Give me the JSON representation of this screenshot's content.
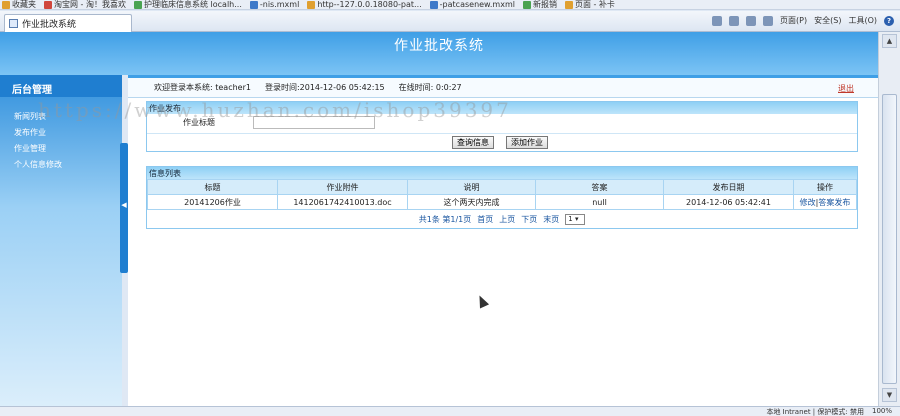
{
  "browser": {
    "favorites_label": "收藏夹",
    "bookmarks": [
      {
        "label": "淘宝网 - 淘！我喜欢"
      },
      {
        "label": "护理临床信息系统 localh..."
      },
      {
        "label": "-nis.mxml"
      },
      {
        "label": "http--127.0.0.18080-pat..."
      },
      {
        "label": "-patcasenew.mxml"
      },
      {
        "label": "新报销"
      },
      {
        "label": "页面 - 补卡"
      }
    ],
    "tab_title": "作业批改系统",
    "tools": {
      "page": "页面(P)",
      "safety": "安全(S)",
      "tools": "工具(O)"
    },
    "status": {
      "zone": "本地 Intranet | 保护模式: 禁用",
      "zoom": "100%"
    }
  },
  "app": {
    "title": "作业批改系统"
  },
  "sidebar": {
    "title": "后台管理",
    "items": [
      {
        "label": "新闻列表"
      },
      {
        "label": "发布作业"
      },
      {
        "label": "作业管理"
      },
      {
        "label": "个人信息修改"
      }
    ],
    "toggle": "◀"
  },
  "header": {
    "welcome": "欢迎登录本系统: teacher1",
    "login_time": "登录时间:2014-12-06 05:42:15",
    "online_time": "在线时间: 0:0:27",
    "logout": "退出"
  },
  "search_panel": {
    "title": "作业发布",
    "field_label": "作业标题",
    "field_value": "",
    "query_button": "查询信息",
    "add_button": "添加作业"
  },
  "list_panel": {
    "title": "信息列表",
    "columns": [
      "标题",
      "作业附件",
      "说明",
      "答案",
      "发布日期",
      "操作"
    ],
    "rows": [
      {
        "title": "20141206作业",
        "attachment": "1412061742410013.doc",
        "note": "这个两天内完成",
        "answer": "null",
        "date": "2014-12-06 05:42:41",
        "action_edit": "修改",
        "separator": "|",
        "action_publish": "答案发布"
      }
    ],
    "pager": {
      "summary": "共1条 第1/1页",
      "first": "首页",
      "prev": "上页",
      "next": "下页",
      "last": "末页",
      "page_value": "1"
    }
  },
  "watermark": "https://www.huzhan.com/ishop39397"
}
